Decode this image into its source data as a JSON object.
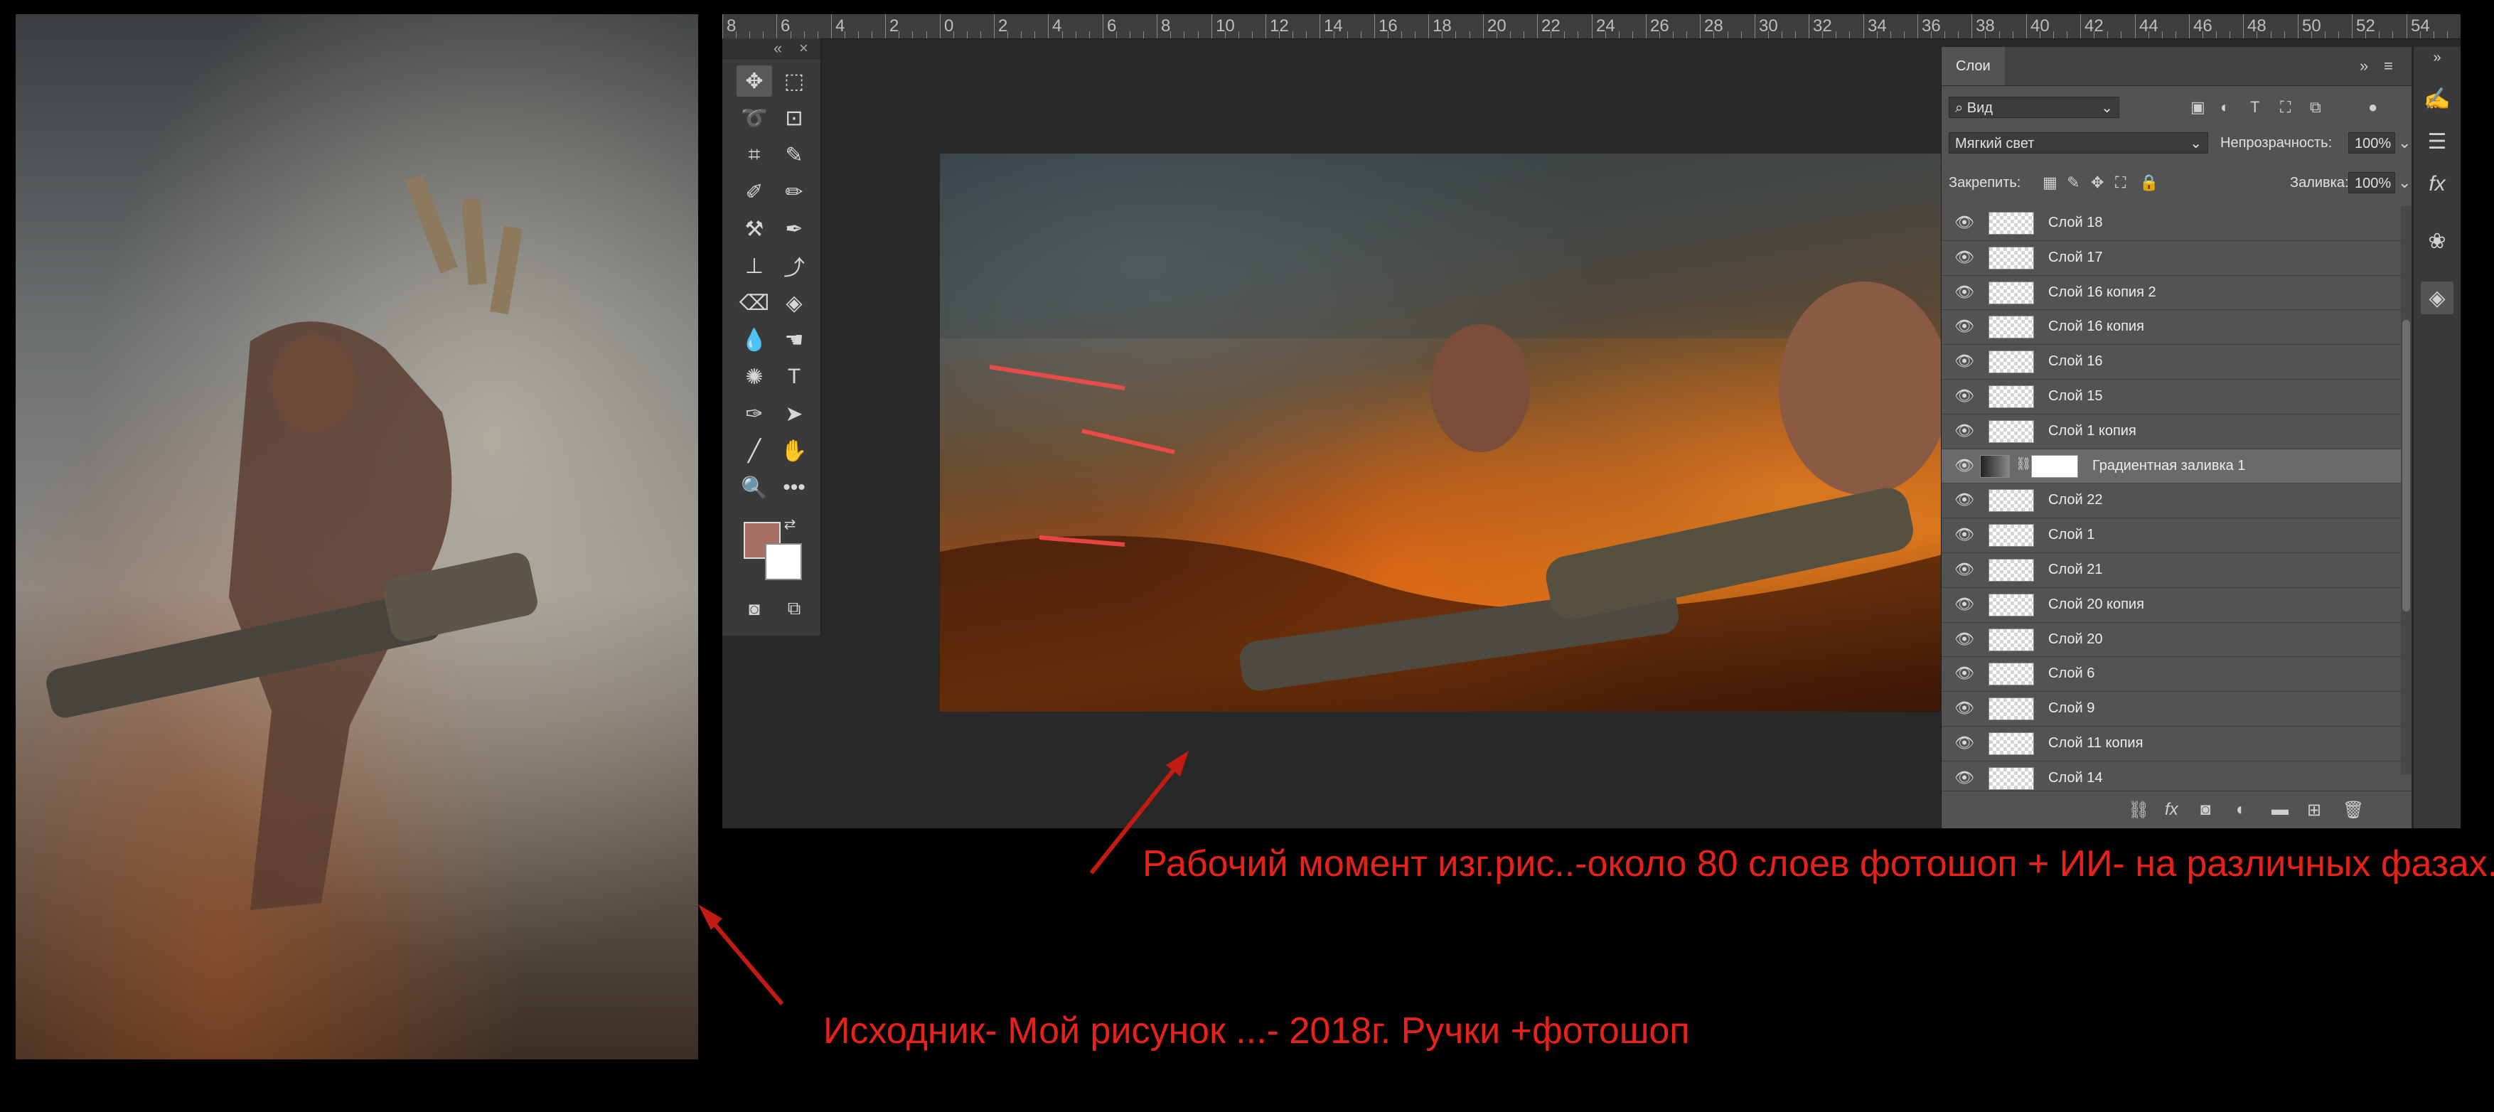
{
  "original_image": {
    "alt": "warrior-with-minigun-illustration"
  },
  "ruler": {
    "labels": [
      "8",
      "6",
      "4",
      "2",
      "0",
      "2",
      "4",
      "6",
      "8",
      "10",
      "12",
      "14",
      "16",
      "18",
      "20",
      "22",
      "24",
      "26",
      "28",
      "30",
      "32",
      "34",
      "36",
      "38",
      "40",
      "42",
      "44",
      "46",
      "48",
      "50",
      "52",
      "54"
    ]
  },
  "toolbar": {
    "collapse": "«",
    "close": "×",
    "tools": [
      "move",
      "marquee",
      "lasso",
      "object-select",
      "crop",
      "eyedropper",
      "healing-brush",
      "brush",
      "clone-stamp",
      "history-brush",
      "eraser",
      "paint-bucket",
      "blur",
      "dodge",
      "pen",
      "type",
      "path-select",
      "hand",
      "line",
      "zoom",
      "more",
      "edit-toolbar"
    ]
  },
  "layers_panel": {
    "tab": "Слои",
    "filter": {
      "value": "Вид"
    },
    "blend_mode": {
      "value": "Мягкий свет"
    },
    "opacity_label": "Непрозрачность:",
    "opacity_value": "100%",
    "lock_label": "Закрепить:",
    "fill_label": "Заливка:",
    "fill_value": "100%",
    "layers": [
      {
        "name": "Слой 18"
      },
      {
        "name": "Слой 17"
      },
      {
        "name": "Слой 16 копия 2"
      },
      {
        "name": "Слой 16 копия"
      },
      {
        "name": "Слой 16"
      },
      {
        "name": "Слой 15"
      },
      {
        "name": "Слой 1 копия"
      },
      {
        "name": "Градиентная заливка 1",
        "selected": true,
        "type": "gradient"
      },
      {
        "name": "Слой 22"
      },
      {
        "name": "Слой 1"
      },
      {
        "name": "Слой 21"
      },
      {
        "name": "Слой 20 копия"
      },
      {
        "name": "Слой 20"
      },
      {
        "name": "Слой 6"
      },
      {
        "name": "Слой 9"
      },
      {
        "name": "Слой 11 копия"
      },
      {
        "name": "Слой 14"
      }
    ]
  },
  "annotations": {
    "note1": "Рабочий момент изг.рис..-около 80 слоев фотошоп + ИИ- на различных фазах.",
    "note2": "Исходник- Мой рисунок ...- 2018г.    Ручки +фотошоп"
  },
  "colors": {
    "annotation": "#e8221b",
    "foreground_swatch": "#a56f66",
    "background_swatch": "#ffffff"
  }
}
